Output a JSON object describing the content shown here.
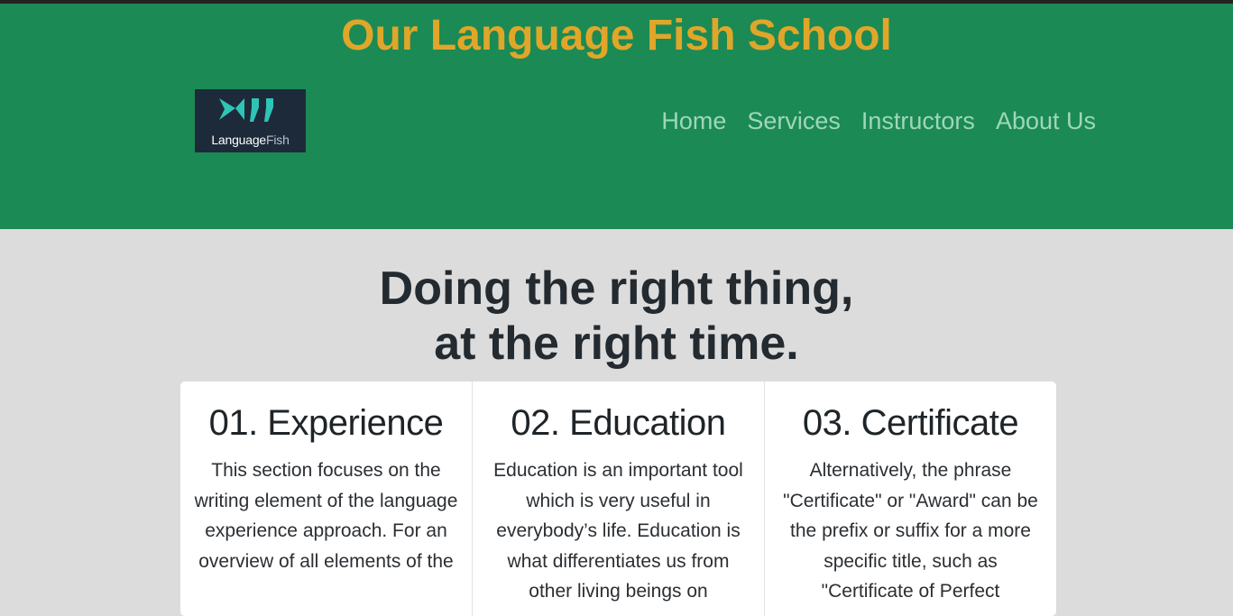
{
  "header": {
    "title": "Our Language Fish School",
    "logo": {
      "word_bold": "Language",
      "word_light": "Fish"
    },
    "nav": [
      "Home",
      "Services",
      "Instructors",
      "About Us"
    ]
  },
  "hero": {
    "line1": "Doing the right thing,",
    "line2": "at the right time."
  },
  "cards": [
    {
      "title": "01. Experience",
      "text": "This section focuses on the writing element of the language experience approach. For an overview of all elements of the"
    },
    {
      "title": "02. Education",
      "text": "Education is an important tool which is very useful in everybody’s life. Education is what differentiates us from other living beings on"
    },
    {
      "title": "03. Certificate",
      "text": "Alternatively, the phrase \"Certificate\" or \"Award\" can be the prefix or suffix for a more specific title, such as \"Certificate of Perfect"
    }
  ],
  "colors": {
    "header_bg": "#1b8a55",
    "title": "#e0a62a",
    "nav_link": "#9fd7b8",
    "page_bg": "#dcdcdc",
    "logo_bg": "#1d2a3a",
    "logo_icon": "#2ec4b6"
  }
}
